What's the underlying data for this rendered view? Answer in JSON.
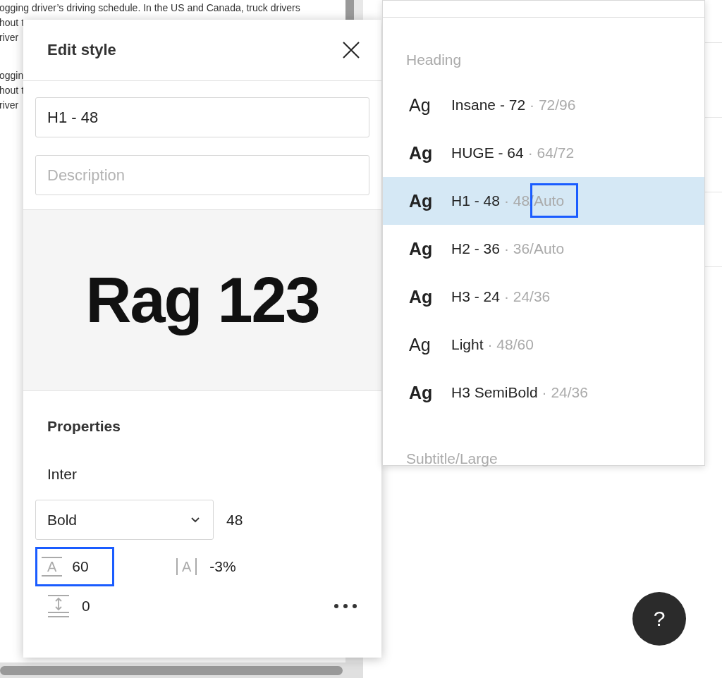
{
  "document_paragraphs": [
    [
      "ogging driver’s driving schedule. In the US and Canada, truck drivers",
      "hout t",
      "river"
    ],
    [
      "oggin",
      "hout t",
      "river"
    ]
  ],
  "edit_style": {
    "title": "Edit style",
    "name_value": "H1 - 48",
    "description_placeholder": "Description",
    "preview": "Rag 123",
    "properties_title": "Properties",
    "font_family": "Inter",
    "font_weight": "Bold",
    "font_size": "48",
    "line_height": {
      "icon": "A",
      "value": "60",
      "highlighted": true
    },
    "letter_spacing": {
      "icon": "A",
      "value": "-3%"
    },
    "paragraph_spacing": "0"
  },
  "style_list": {
    "groups": [
      {
        "title": "Heading",
        "items": [
          {
            "sample": "Ag",
            "bold": false,
            "name": "Insane - 72",
            "meta": "· 72/96",
            "selected": false,
            "highlighted": false
          },
          {
            "sample": "Ag",
            "bold": true,
            "name": "HUGE - 64",
            "meta": "· 64/72",
            "selected": false,
            "highlighted": false
          },
          {
            "sample": "Ag",
            "bold": true,
            "name": "H1 - 48",
            "meta": "· 48/Auto",
            "selected": true,
            "highlighted": true
          },
          {
            "sample": "Ag",
            "bold": true,
            "name": "H2 - 36",
            "meta": "· 36/Auto",
            "selected": false,
            "highlighted": false
          },
          {
            "sample": "Ag",
            "bold": true,
            "name": "H3 - 24",
            "meta": "· 24/36",
            "selected": false,
            "highlighted": false
          },
          {
            "sample": "Ag",
            "bold": false,
            "name": "Light",
            "meta": "· 48/60",
            "selected": false,
            "highlighted": false
          },
          {
            "sample": "Ag",
            "bold": true,
            "name": "H3 SemiBold",
            "meta": "· 24/36",
            "selected": false,
            "highlighted": false
          }
        ]
      },
      {
        "title": "Subtitle/Large"
      }
    ]
  },
  "help_button": "?"
}
